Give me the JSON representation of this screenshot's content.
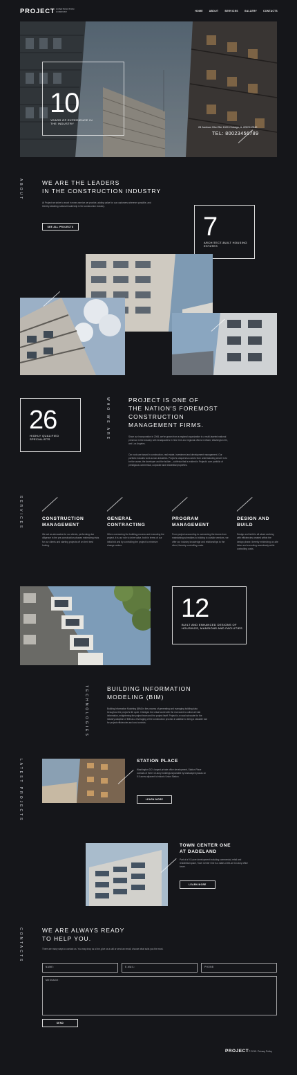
{
  "header": {
    "logo": "PROJECT",
    "logo_sub": "CONSTRUCTION COMPANY",
    "nav": [
      "HOME",
      "ABOUT",
      "SERVICES",
      "GALLERY",
      "CONTACTS"
    ]
  },
  "hero": {
    "number": "10",
    "caption": "YEARS OF EXPERIENCE IN THE INDUSTRY",
    "address": "28 Jackson Blvd Ste 1020 Chicago, IL 60604-2340",
    "phone": "TEL: 80023456789"
  },
  "about": {
    "section_label": "ABOUT",
    "heading_line1": "WE ARE THE LEADERS",
    "heading_line2": "IN THE CONSTRUCTION INDUSTRY",
    "text": "At Project we strive to excel in every service we provide, adding value for our customers wherever possible, and thereby attaining national leadership in the construction industry.",
    "button": "SEE ALL PROJECTS",
    "stat_number": "7",
    "stat_caption": "ARCHITECT-BUILT HOUSING ESTATES"
  },
  "who": {
    "section_label": "WHO WE ARE",
    "stat_number": "26",
    "stat_caption": "HIGHLY QUALIFIED SPECIALISTS",
    "heading": "PROJECT IS ONE OF THE NATION'S FOREMOST CONSTRUCTION MANAGEMENT FIRMS.",
    "heading_lines": [
      "PROJECT IS ONE OF",
      "THE NATION'S FOREMOST",
      "CONSTRUCTION",
      "MANAGEMENT FIRMS."
    ],
    "para1": "Since our incorporation in 2006, we've grown from a regional organization to a multi-faceted national presence in the industry with headquarters in New York and regional offices in Miami, Washington DC, and Los Angeles.",
    "para2": "Our roots are based in construction, real estate, investment and development management. Our portfolio includes work across industries. Project's uniqueness comes from understanding what it is to be the owner, the developer and the builder – a trifecta that is evident in Project's core portfolio of prestigious commercial, corporate and residential properties."
  },
  "services": {
    "section_label": "SERVICES",
    "items": [
      {
        "title1": "CONSTRUCTION",
        "title2": "MANAGEMENT",
        "text": "We act as advocates for our clients, performing due diligence in the pre-construction phases minimizing risks for our clients and starting projects off on their best footing."
      },
      {
        "title1": "GENERAL",
        "title2": "CONTRACTING",
        "text": "When overseeing the building process and executing the project, it is our role to drive value, both in terms of our initial bid and by controlling the project to minimize change orders."
      },
      {
        "title1": "PROGRAM",
        "title2": "MANAGEMENT",
        "text": "From project accounting to overseeing the teams from maintaining schedules to bidding to outside vendors, we offer our industry knowledge and relationships to the client, thereby controlling costs."
      },
      {
        "title1": "DESIGN AND",
        "title2": "BUILD",
        "text": "Design and build is all about working with efficiencies created within the design phase, thereby minimizing on-site labor and executing seamlessly while controlling costs."
      }
    ]
  },
  "designs": {
    "stat_number": "12",
    "stat_caption": "BUILT AND ENHANCED DESIGNS OF HOUSINGS, MANSIONS AND FACILITIES"
  },
  "tech": {
    "section_label": "TECHNOLOGIES",
    "heading_line1": "BUILDING INFORMATION",
    "heading_line2": "MODELING (BIM)",
    "text": "Building Information Modeling (BIM) is the process of generating and managing building data throughout the project's life cycle. It bridges the virtual world with the real world to collect all vital information, enlightening the project team and the project itself. Project is a vocal advocate for the industry adoption of BIM as a leveraging of the construction process in addition to being a valuable tool for project efficiencies and cost controls."
  },
  "projects": {
    "section_label": "LATEST PROJECTS",
    "items": [
      {
        "title": "STATION PLACE",
        "text": "Washington DC's largest private office development, Station Place consists of three 10-story buildings separated by landscaped plazas on 5.5 acres adjacent to historic Union Station.",
        "button": "LEARN MORE"
      },
      {
        "title1": "TOWN CENTER ONE",
        "title2": "AT DADELAND",
        "text": "Part of a 9.5-acre development including commercial, retail and residential space, Town Center One is a state-of-the-art 10-story office tower.",
        "button": "LEARN MORE"
      }
    ]
  },
  "contacts": {
    "section_label": "CONTACTS",
    "heading_line1": "WE ARE ALWAYS READY",
    "heading_line2": "TO HELP YOU.",
    "text": "There are many ways to contact us. You may drop us a line, give us a call or send an email, choose what suits you the most.",
    "fields": {
      "name": "NAME:",
      "email": "E-MAIL:",
      "phone": "PHONE:",
      "message": "MESSAGE:"
    },
    "submit": "SEND"
  },
  "footer": {
    "logo": "PROJECT",
    "copyright": "© 2015. Privacy Policy"
  },
  "colors": {
    "background": "#15161a",
    "text": "#ffffff",
    "muted": "#a3a5ab"
  }
}
